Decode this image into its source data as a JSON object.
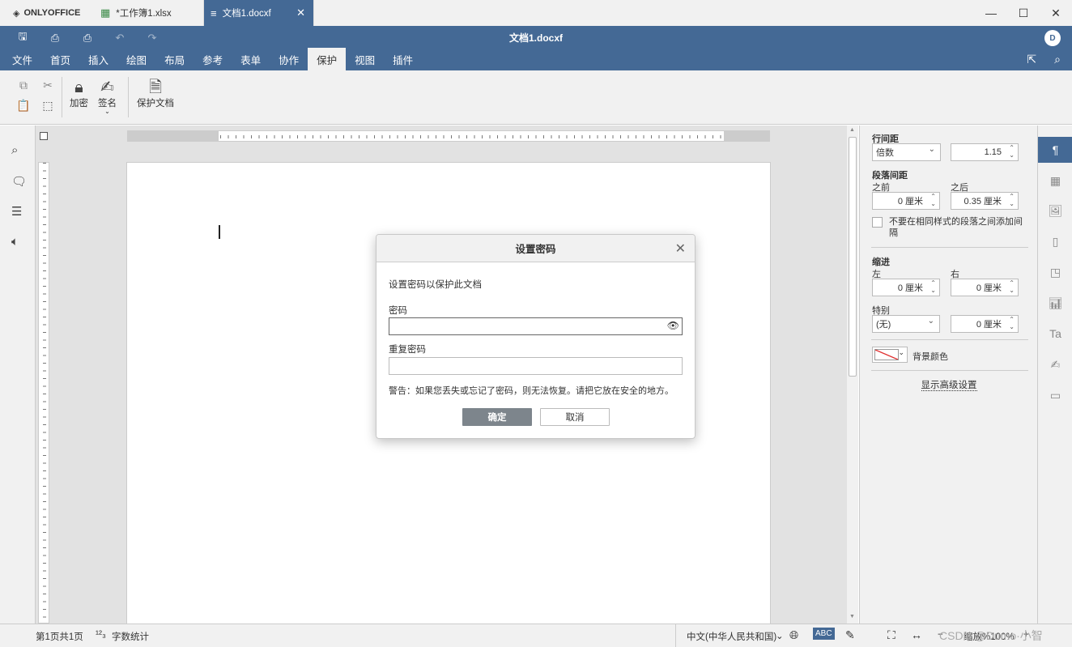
{
  "app": {
    "logo_text": "ONLYOFFICE"
  },
  "tabs": [
    {
      "label": "*工作簿1.xlsx",
      "type": "spreadsheet"
    },
    {
      "label": "文档1.docxf",
      "type": "document",
      "active": true
    }
  ],
  "header": {
    "title": "文档1.docxf",
    "avatar_initial": "D"
  },
  "menu": {
    "tabs": [
      "文件",
      "首页",
      "插入",
      "绘图",
      "布局",
      "参考",
      "表单",
      "协作",
      "保护",
      "视图",
      "插件"
    ],
    "active_index": 8
  },
  "toolbar": {
    "encrypt_label": "加密",
    "sign_label": "签名",
    "protect_doc_label": "保护文档"
  },
  "right_panel": {
    "line_spacing_label": "行间距",
    "line_spacing_mode": "倍数",
    "line_spacing_value": "1.15",
    "para_spacing_label": "段落间距",
    "before_label": "之前",
    "after_label": "之后",
    "before_value": "0 厘米",
    "after_value": "0.35 厘米",
    "no_space_same_style": "不要在相同样式的段落之间添加间隔",
    "indent_label": "缩进",
    "left_label": "左",
    "right_label": "右",
    "indent_left_value": "0 厘米",
    "indent_right_value": "0 厘米",
    "special_label": "特别",
    "special_value": "(无)",
    "special_amount": "0 厘米",
    "bg_color_label": "背景颜色",
    "advanced_link": "显示高级设置"
  },
  "dialog": {
    "title": "设置密码",
    "description": "设置密码以保护此文档",
    "password_label": "密码",
    "password_value": "",
    "repeat_label": "重复密码",
    "repeat_value": "",
    "warning": "警告：如果您丢失或忘记了密码，则无法恢复。请把它放在安全的地方。",
    "ok_label": "确定",
    "cancel_label": "取消"
  },
  "status": {
    "page_info": "第1页共1页",
    "word_count": "字数统计",
    "language": "中文(中华人民共和国)",
    "zoom_label": "缩放%100%",
    "watermark": "CSDN @Dumo·小智"
  },
  "colors": {
    "accent": "#446995",
    "toolbar_bg": "#f1f1f1",
    "dialog_ok": "#7d858c"
  }
}
